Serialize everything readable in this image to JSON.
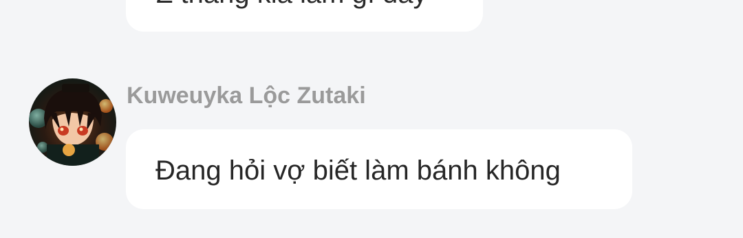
{
  "previous_message": {
    "text": "Z thằng kia làm gì đấy"
  },
  "message": {
    "sender_name": "Kuweuyka Lộc Zutaki",
    "text": "Đang hỏi vợ biết làm bánh không"
  },
  "colors": {
    "background": "#f4f5f7",
    "bubble": "#ffffff",
    "sender_name": "#9a9a9a",
    "message_text": "#262626"
  }
}
